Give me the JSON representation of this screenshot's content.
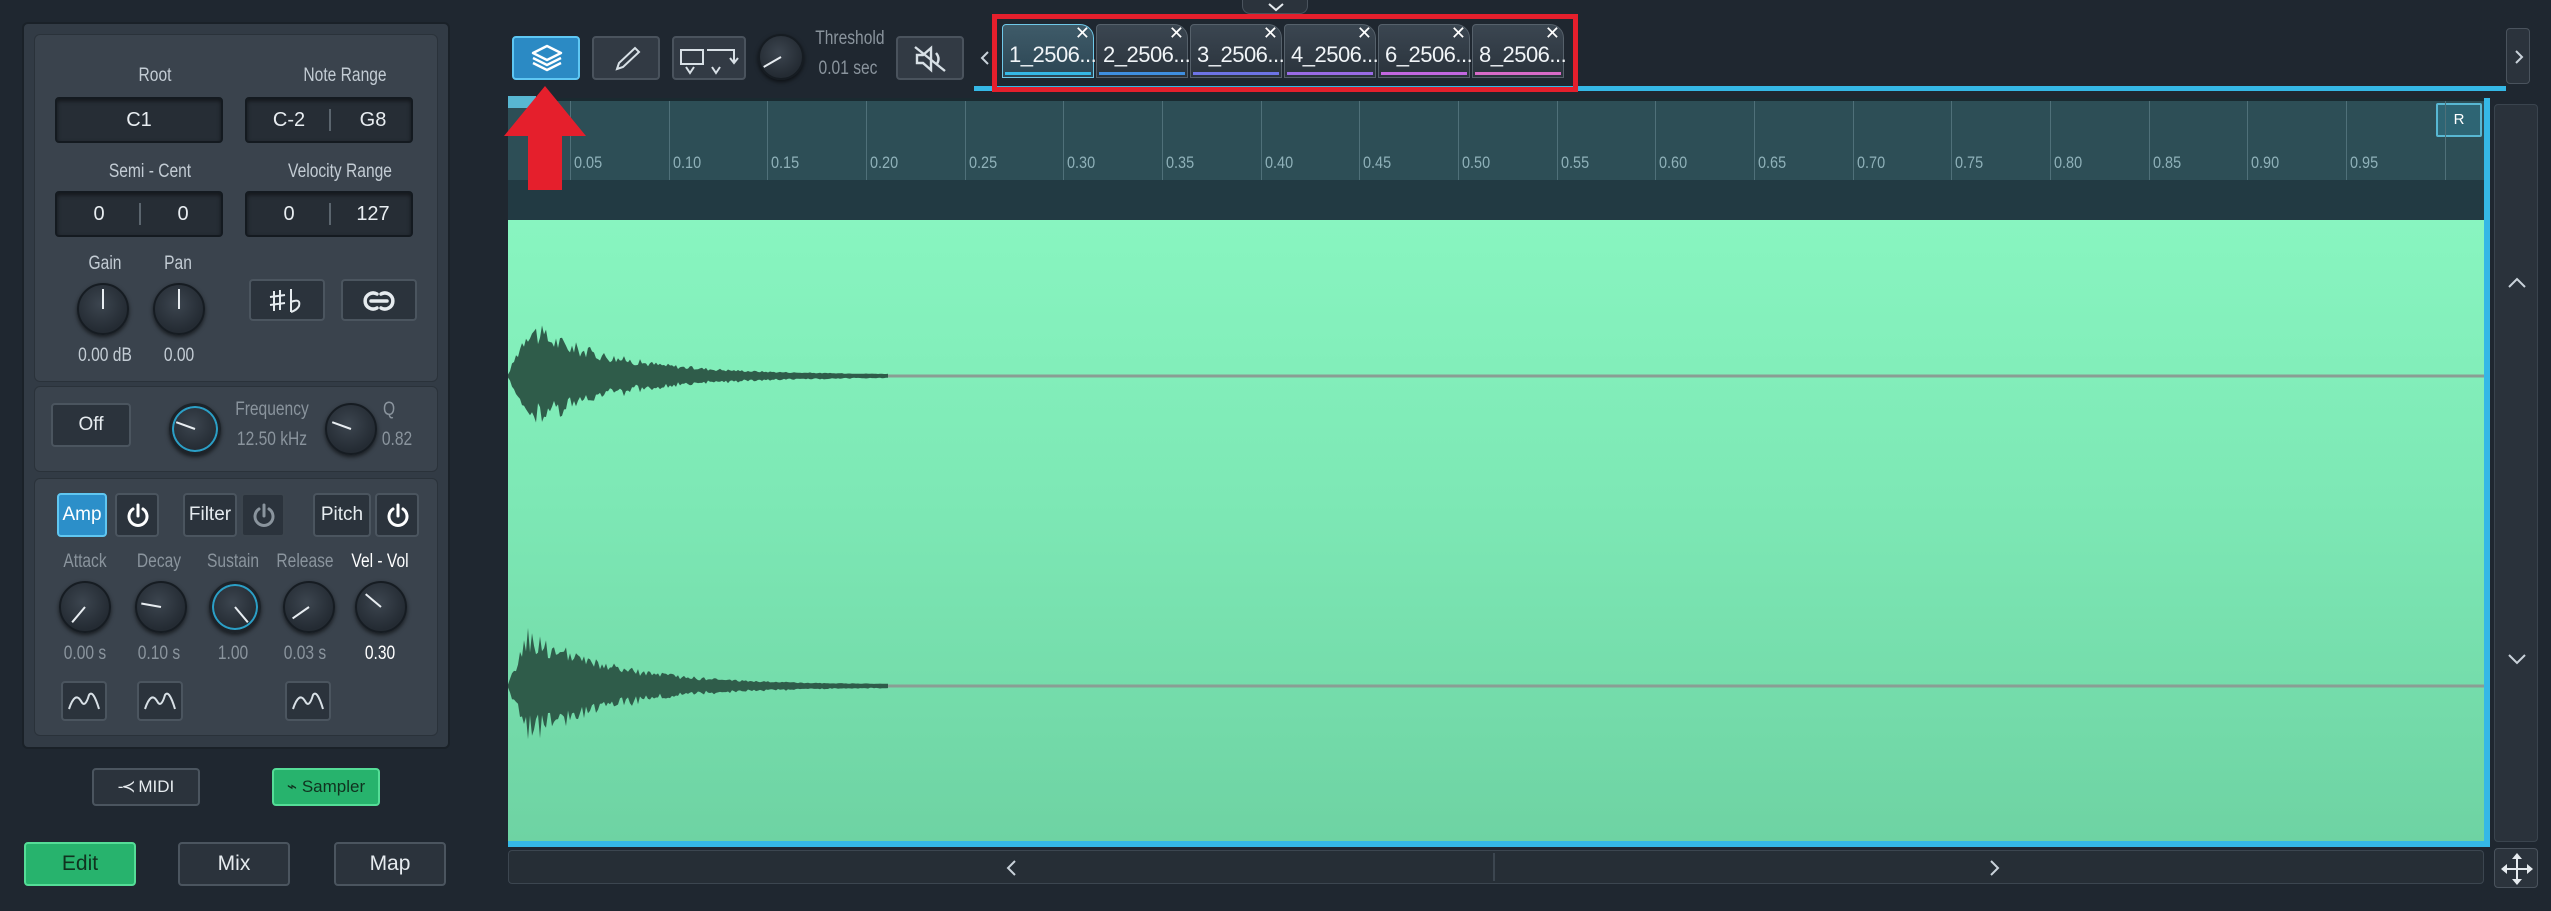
{
  "colors": {
    "accent": "#35b8e6",
    "active_button": "#2c8fc9",
    "green_button": "#27b36d",
    "waveform_bg": "#7de8b5",
    "waveform": "#2f5c4a",
    "highlight_box": "#e51f2c",
    "arrow": "#e51f2c"
  },
  "sample_settings": {
    "root_label": "Root",
    "root_value": "C1",
    "note_range_label": "Note Range",
    "note_range_low": "C-2",
    "note_range_high": "G8",
    "semi_cent_label": "Semi - Cent",
    "semi_value": "0",
    "cent_value": "0",
    "velocity_range_label": "Velocity Range",
    "velocity_low": "0",
    "velocity_high": "127",
    "gain_label": "Gain",
    "gain_value": "0.00 dB",
    "pan_label": "Pan",
    "pan_value": "0.00",
    "sharp_flat_icon": "sharp-flat-icon",
    "loop_icon": "loop-icon"
  },
  "filter": {
    "mode_button": "Off",
    "frequency_label": "Frequency",
    "frequency_value": "12.50 kHz",
    "q_label": "Q",
    "q_value": "0.82"
  },
  "envelope": {
    "tabs": [
      "Amp",
      "Filter",
      "Pitch"
    ],
    "active_tab": "Amp",
    "attack_label": "Attack",
    "attack_value": "0.00 s",
    "decay_label": "Decay",
    "decay_value": "0.10 s",
    "sustain_label": "Sustain",
    "sustain_value": "1.00",
    "release_label": "Release",
    "release_value": "0.03 s",
    "vel_vol_label": "Vel - Vol",
    "vel_vol_value": "0.30"
  },
  "mode_buttons": {
    "midi": "MIDI",
    "sampler": "Sampler"
  },
  "bottom_tabs": {
    "edit": "Edit",
    "mix": "Mix",
    "map": "Map"
  },
  "toolbar": {
    "threshold_label": "Threshold",
    "threshold_value": "0.01 sec"
  },
  "sample_tabs": [
    {
      "label": "1_2506...",
      "color": "#35b8e6"
    },
    {
      "label": "2_2506...",
      "color": "#3f8fe0"
    },
    {
      "label": "3_2506...",
      "color": "#6d74e6"
    },
    {
      "label": "4_2506...",
      "color": "#9a6be6"
    },
    {
      "label": "6_2506...",
      "color": "#c267e0"
    },
    {
      "label": "8_2506...",
      "color": "#d96bc8"
    }
  ],
  "ruler": {
    "ticks": [
      "0.05",
      "0.10",
      "0.15",
      "0.20",
      "0.25",
      "0.30",
      "0.35",
      "0.40",
      "0.45",
      "0.50",
      "0.55",
      "0.60",
      "0.65",
      "0.70",
      "0.75",
      "0.80",
      "0.85",
      "0.90",
      "0.95"
    ],
    "region_marker": "R"
  }
}
